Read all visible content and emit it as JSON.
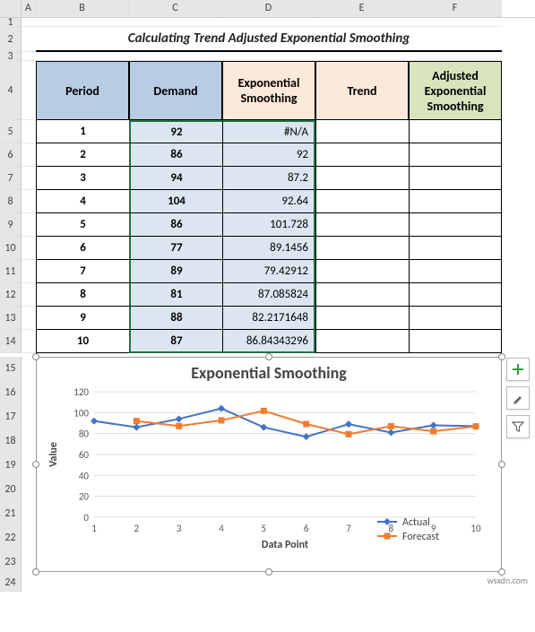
{
  "columns": [
    "A",
    "B",
    "C",
    "D",
    "E",
    "F"
  ],
  "title": "Calculating Trend Adjusted Exponential Smoothing",
  "headers": {
    "period": "Period",
    "demand": "Demand",
    "exp": "Exponential Smoothing",
    "trend": "Trend",
    "adj": "Adjusted Exponential Smoothing"
  },
  "rows": [
    {
      "period": "1",
      "demand": "92",
      "exp": "#N/A"
    },
    {
      "period": "2",
      "demand": "86",
      "exp": "92"
    },
    {
      "period": "3",
      "demand": "94",
      "exp": "87.2"
    },
    {
      "period": "4",
      "demand": "104",
      "exp": "92.64"
    },
    {
      "period": "5",
      "demand": "86",
      "exp": "101.728"
    },
    {
      "period": "6",
      "demand": "77",
      "exp": "89.1456"
    },
    {
      "period": "7",
      "demand": "89",
      "exp": "79.42912"
    },
    {
      "period": "8",
      "demand": "81",
      "exp": "87.085824"
    },
    {
      "period": "9",
      "demand": "88",
      "exp": "82.2171648"
    },
    {
      "period": "10",
      "demand": "87",
      "exp": "86.84343296"
    }
  ],
  "chart_data": {
    "type": "line",
    "title": "Exponential Smoothing",
    "xlabel": "Data Point",
    "ylabel": "Value",
    "x": [
      1,
      2,
      3,
      4,
      5,
      6,
      7,
      8,
      9,
      10
    ],
    "ylim": [
      0,
      120
    ],
    "yticks": [
      0,
      20,
      40,
      60,
      80,
      100,
      120
    ],
    "series": [
      {
        "name": "Actual",
        "color": "#4472C4",
        "marker": "diamond",
        "values": [
          92,
          86,
          94,
          104,
          86,
          77,
          89,
          81,
          88,
          87
        ]
      },
      {
        "name": "Forecast",
        "color": "#ED7D31",
        "marker": "square",
        "values": [
          null,
          92,
          87.2,
          92.64,
          101.728,
          89.1456,
          79.42912,
          87.085824,
          82.2171648,
          86.84343296
        ]
      }
    ]
  },
  "legend": {
    "actual": "Actual",
    "forecast": "Forecast"
  },
  "side_tools": {
    "add": "+",
    "brush": "brush",
    "filter": "filter"
  },
  "watermark": "wsxdn.com"
}
